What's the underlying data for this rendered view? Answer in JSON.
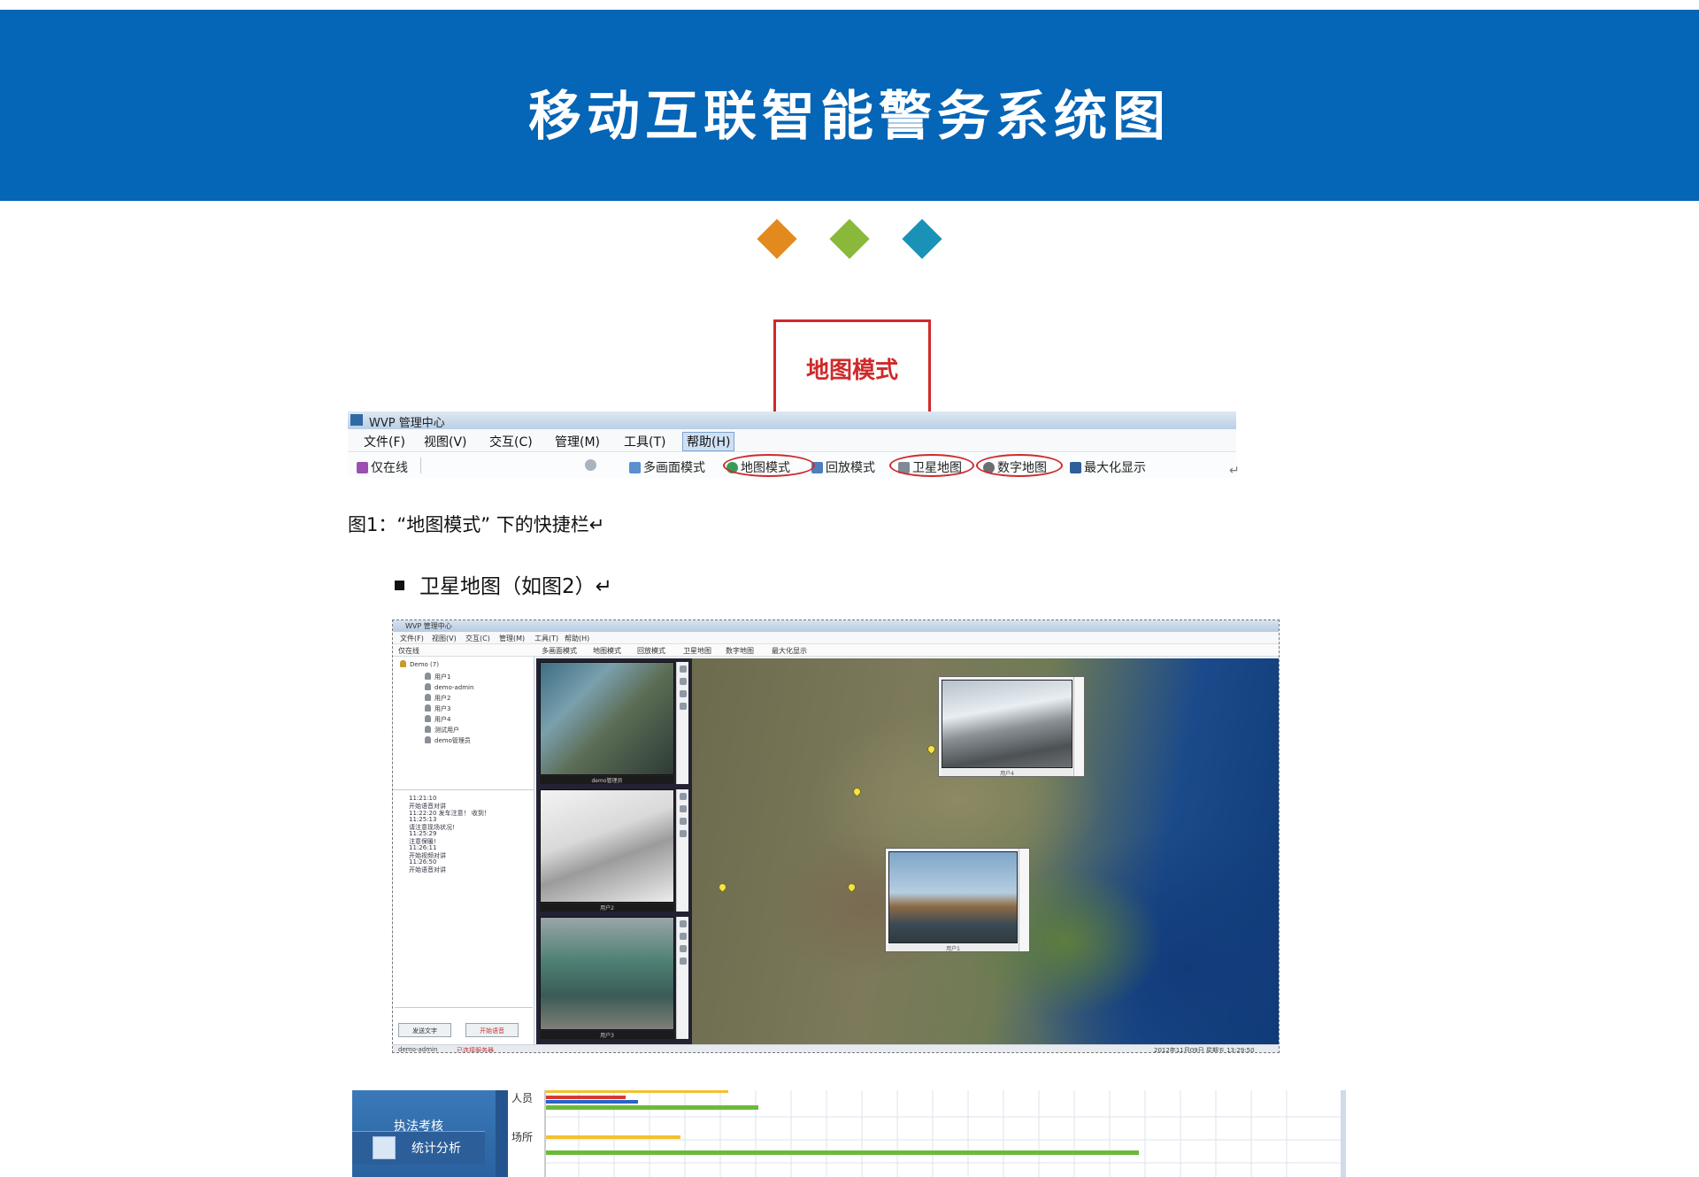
{
  "header": {
    "title": "移动互联智能警务系统图"
  },
  "decor": {
    "diamond_colors": [
      "#e38a1e",
      "#8ab83a",
      "#1a92b8"
    ],
    "banner_color": "#0565b6",
    "callout_color": "#cf2a2a"
  },
  "callout": {
    "label": "地图模式"
  },
  "figure1": {
    "window_title": "WVP 管理中心",
    "menu": [
      "文件(F)",
      "视图(V)",
      "交互(C)",
      "管理(M)",
      "工具(T)",
      "帮助(H)"
    ],
    "toolbar": {
      "online_only": "仅在线",
      "multi_screen": "多画面模式",
      "map_mode": "地图模式",
      "playback_mode": "回放模式",
      "satellite_map": "卫星地图",
      "digital_map": "数字地图",
      "maximize": "最大化显示"
    },
    "return_mark": "↵",
    "caption": "图1：“地图模式” 下的快捷栏↵"
  },
  "bullet": {
    "text": "卫星地图（如图2）↵"
  },
  "figure2": {
    "window_title": "WVP 管理中心",
    "menu": [
      "文件(F)",
      "视图(V)",
      "交互(C)",
      "管理(M)",
      "工具(T)",
      "帮助(H)"
    ],
    "toolbar": {
      "online_only": "仅在线",
      "multi_screen": "多画面模式",
      "map_mode": "地图模式",
      "playback_mode": "回放模式",
      "satellite_map": "卫星地图",
      "digital_map": "数字地图",
      "maximize": "最大化显示"
    },
    "tree": {
      "root": "Demo (7)",
      "users": [
        "用户1",
        "demo-admin",
        "用户2",
        "用户3",
        "用户4",
        "测试用户",
        "demo管理员"
      ]
    },
    "messages": [
      "11:21:10",
      "开始语音对讲",
      "11:22:20  发车注意！ 收到！",
      "11:25:13",
      "请注意现场状况!",
      "11:25:29",
      "注意保暖!",
      "11:26:11",
      "开始视频对讲",
      "11:26:50",
      "开始语音对讲"
    ],
    "buttons": [
      "发送文字",
      "开始语音"
    ],
    "video_captions": [
      "demo管理员",
      "用户2",
      "用户3"
    ],
    "popup_captions": [
      "用户4",
      "用户1"
    ],
    "status_left": "demo-admin",
    "status_alert": "已连接服务器",
    "status_right": "2012年11月09日  星期五  13:29:50"
  },
  "figure3": {
    "nav": [
      "执法考核",
      "统计分析"
    ],
    "row_labels": [
      "人员",
      "场所"
    ],
    "bar_colors": [
      "#f2c12e",
      "#d63b2f",
      "#2b63c6",
      "#6cba3c"
    ]
  }
}
